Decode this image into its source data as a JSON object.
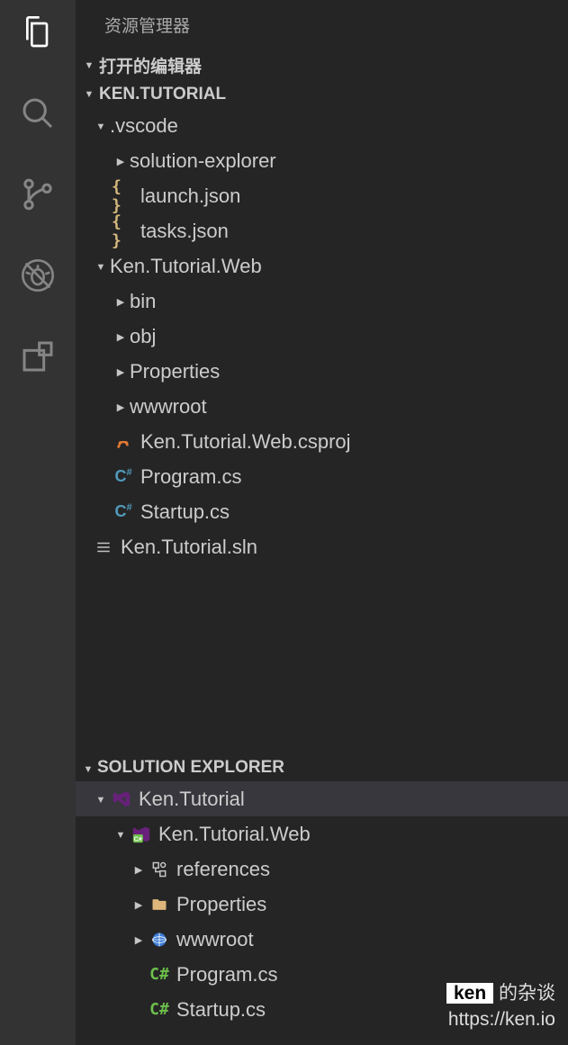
{
  "title": "资源管理器",
  "sections": {
    "openEditors": "打开的编辑器",
    "project": "KEN.TUTORIAL",
    "solution": "SOLUTION EXPLORER"
  },
  "tree": {
    "vscode": ".vscode",
    "solutionExplorerFolder": "solution-explorer",
    "launch": "launch.json",
    "tasks": "tasks.json",
    "web": "Ken.Tutorial.Web",
    "bin": "bin",
    "obj": "obj",
    "properties": "Properties",
    "wwwroot": "wwwroot",
    "csproj": "Ken.Tutorial.Web.csproj",
    "program": "Program.cs",
    "startup": "Startup.cs",
    "sln": "Ken.Tutorial.sln"
  },
  "solution": {
    "root": "Ken.Tutorial",
    "project": "Ken.Tutorial.Web",
    "references": "references",
    "properties": "Properties",
    "wwwroot": "wwwroot",
    "program": "Program.cs",
    "startup": "Startup.cs"
  },
  "watermark": {
    "label": "ken",
    "suffix": " 的杂谈",
    "url": "https://ken.io"
  }
}
